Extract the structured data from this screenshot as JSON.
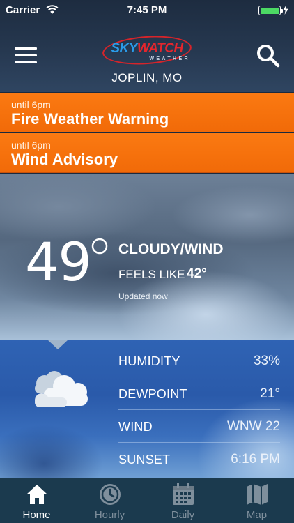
{
  "status_bar": {
    "carrier": "Carrier",
    "time": "7:45 PM",
    "battery_level": 1.0,
    "battery_color": "#4cd964"
  },
  "header": {
    "logo": {
      "sky": "SKY",
      "watch": "WATCH",
      "tagline": "WEATHER"
    },
    "location": "JOPLIN, MO",
    "menu_icon": "hamburger-menu-icon",
    "search_icon": "search-icon"
  },
  "alerts": [
    {
      "until": "until 6pm",
      "title": "Fire Weather Warning"
    },
    {
      "until": "until 6pm",
      "title": "Wind Advisory"
    }
  ],
  "current": {
    "temperature": "49",
    "condition": "CLOUDY/WIND",
    "feels_like_label": "FEELS LIKE",
    "feels_like_value": "42°",
    "updated": "Updated now",
    "condition_icon": "cloudy-icon"
  },
  "details": [
    {
      "label": "HUMIDITY",
      "value": "33%"
    },
    {
      "label": "DEWPOINT",
      "value": "21°"
    },
    {
      "label": "WIND",
      "value": "WNW 22"
    },
    {
      "label": "SUNSET",
      "value": "6:16 PM"
    }
  ],
  "tabs": [
    {
      "label": "Home",
      "icon": "home-icon",
      "active": true
    },
    {
      "label": "Hourly",
      "icon": "clock-icon",
      "active": false
    },
    {
      "label": "Daily",
      "icon": "calendar-icon",
      "active": false
    },
    {
      "label": "Map",
      "icon": "map-icon",
      "active": false
    }
  ],
  "colors": {
    "alert_orange": "#f47310",
    "tabbar_bg": "#1b3a4e",
    "tab_active": "#ffffff",
    "tab_inactive": "#7f8f9c",
    "logo_blue": "#2a9be8",
    "logo_red": "#e3262d"
  }
}
